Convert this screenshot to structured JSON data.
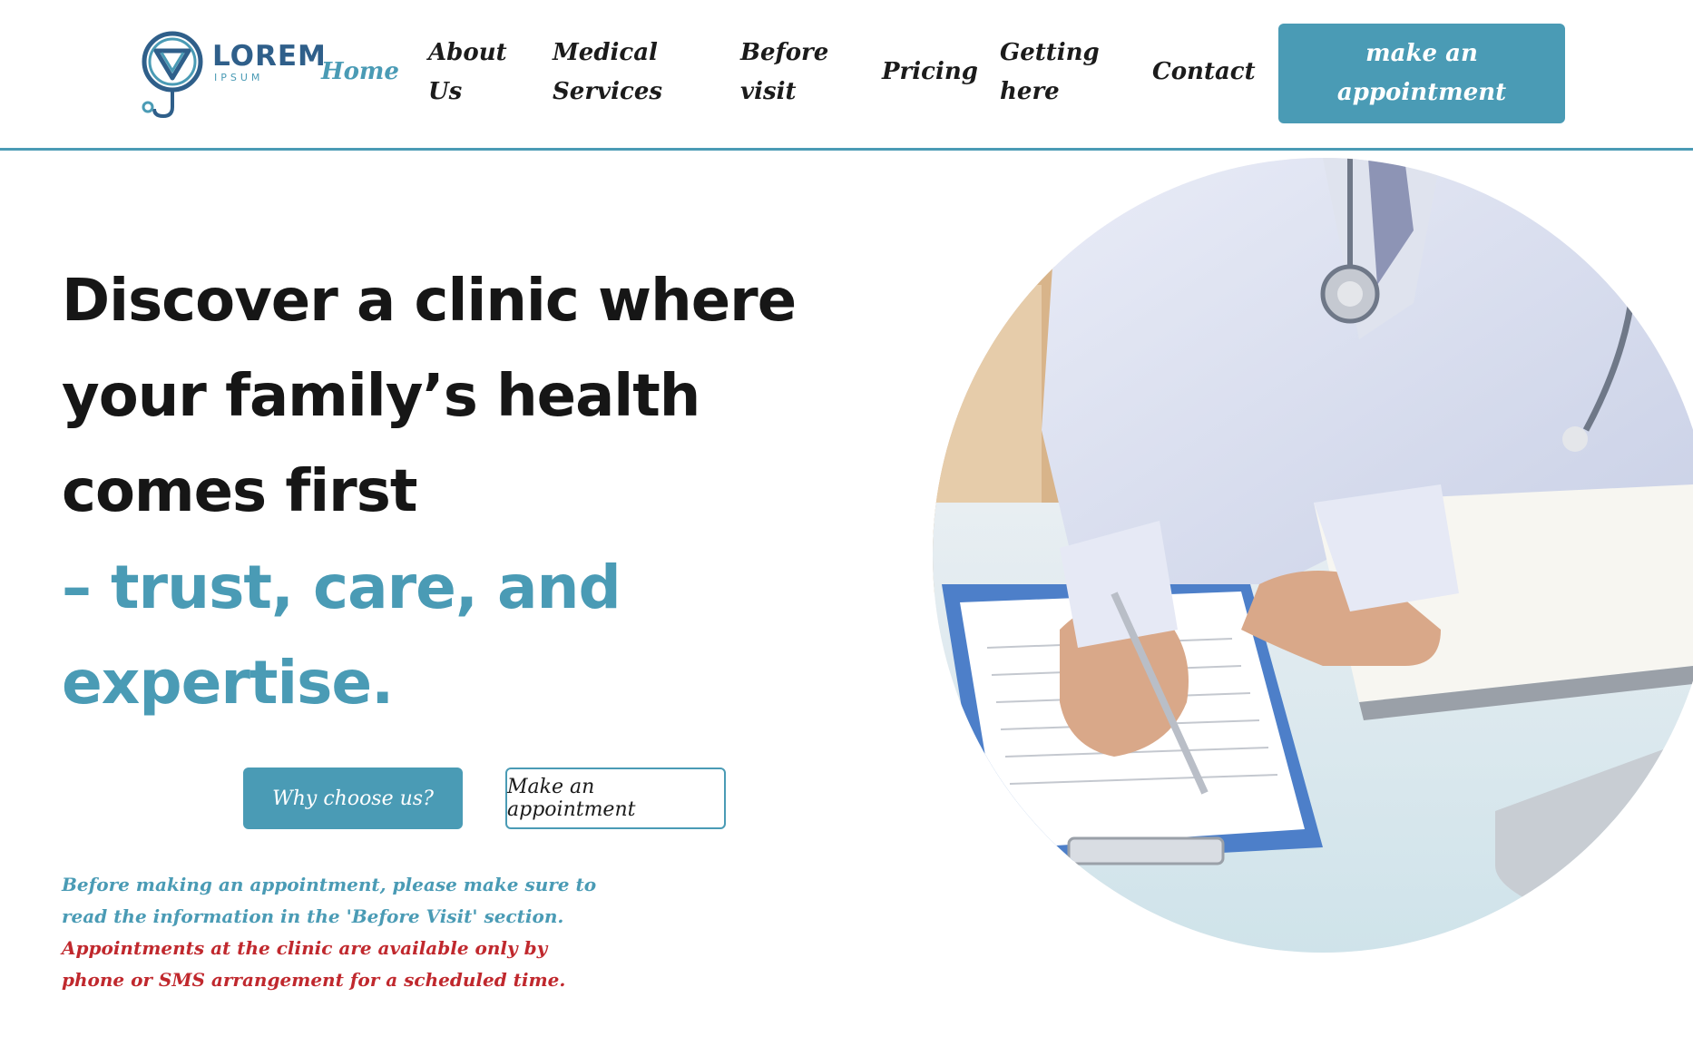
{
  "brand": {
    "name": "LOREM",
    "tagline": "IPSUM"
  },
  "nav": {
    "items": [
      {
        "label": "Home",
        "active": true
      },
      {
        "label": "About Us"
      },
      {
        "label": "Medical Services"
      },
      {
        "label": "Before visit"
      },
      {
        "label": "Pricing"
      },
      {
        "label": "Getting here"
      },
      {
        "label": "Contact"
      }
    ],
    "cta_label": "make an appointment"
  },
  "hero": {
    "title": "Discover a clinic where your family’s health comes first",
    "accent": "– trust, care, and expertise.",
    "primary_button": "Why choose us?",
    "secondary_button": "Make an appointment",
    "notice_info": "Before making an appointment, please make sure to read the information in the 'Before Visit' section.",
    "notice_warning": "Appointments at the clinic are available only by phone or SMS arrangement for a scheduled time.",
    "image_icon": "doctor-writing-photo"
  },
  "colors": {
    "accent": "#4a9bb5",
    "warning": "#c0282d",
    "text": "#161616",
    "logo": "#2f5f8a"
  }
}
